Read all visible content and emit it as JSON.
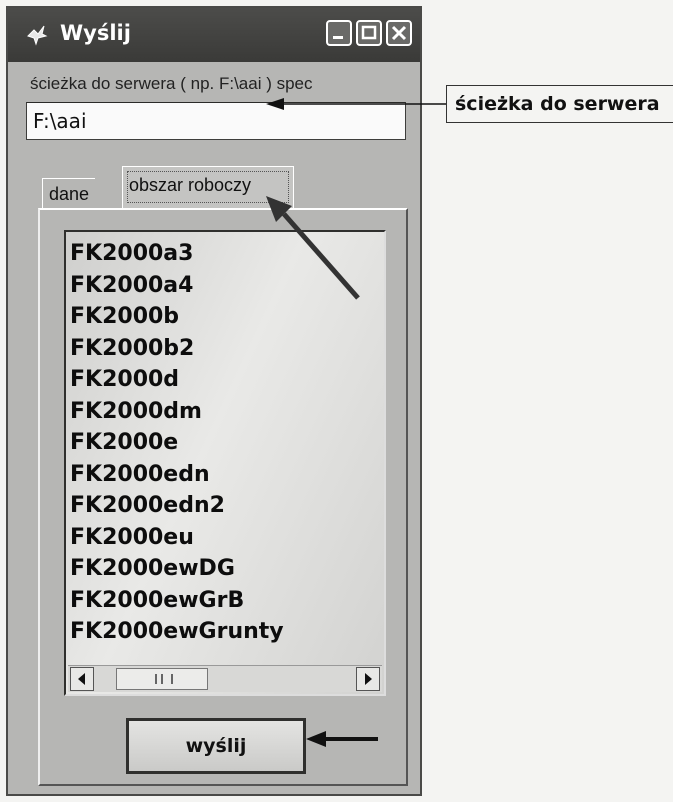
{
  "window": {
    "title": "Wyślij",
    "path_label": "ścieżka do serwera ( np. F:\\aai )   spec",
    "path_value": "F:\\aai"
  },
  "tabs": [
    {
      "label": "dane",
      "active": false
    },
    {
      "label": "obszar roboczy",
      "active": true
    }
  ],
  "list": {
    "items": [
      "FK2000a3",
      "FK2000a4",
      "FK2000b",
      "FK2000b2",
      "FK2000d",
      "FK2000dm",
      "FK2000e",
      "FK2000edn",
      "FK2000edn2",
      "FK2000eu",
      "FK2000ewDG",
      "FK2000ewGrB",
      "FK2000ewGrunty"
    ]
  },
  "send_button": {
    "label": "wyślij"
  },
  "annotation": {
    "callout_text": "ścieżka do serwera"
  },
  "icons": {
    "app": "app-icon",
    "minimize": "minimize-icon",
    "maximize": "maximize-icon",
    "close": "close-icon",
    "scroll_left": "chevron-left-icon",
    "scroll_right": "chevron-right-icon"
  }
}
